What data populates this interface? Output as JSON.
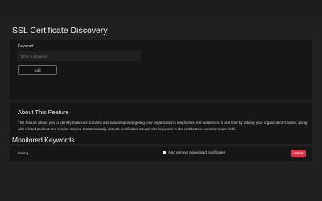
{
  "page": {
    "title": "SSL Certificate Discovery"
  },
  "keyword_form": {
    "label": "Keyword",
    "input_value": "",
    "input_placeholder": "Enter a keyword",
    "add_label": "Add"
  },
  "about": {
    "title": "About This Feature",
    "text": "This feature allows you to identify malicious domains and subdomains targeting your organization's employees and customers in real time by adding your organization's name, along with related product and service names. It automatically detects certificates issued with keywords in the certificate's common name field."
  },
  "monitored": {
    "title": "Monitored Keywords",
    "items": [
      {
        "keyword": "testing",
        "remove_associated_label": "Also remove associated certificates",
        "remove_associated_checked": false,
        "delete_label": "Delete"
      }
    ]
  },
  "colors": {
    "background": "#202020",
    "card": "#161616",
    "danger": "#d9364a"
  }
}
